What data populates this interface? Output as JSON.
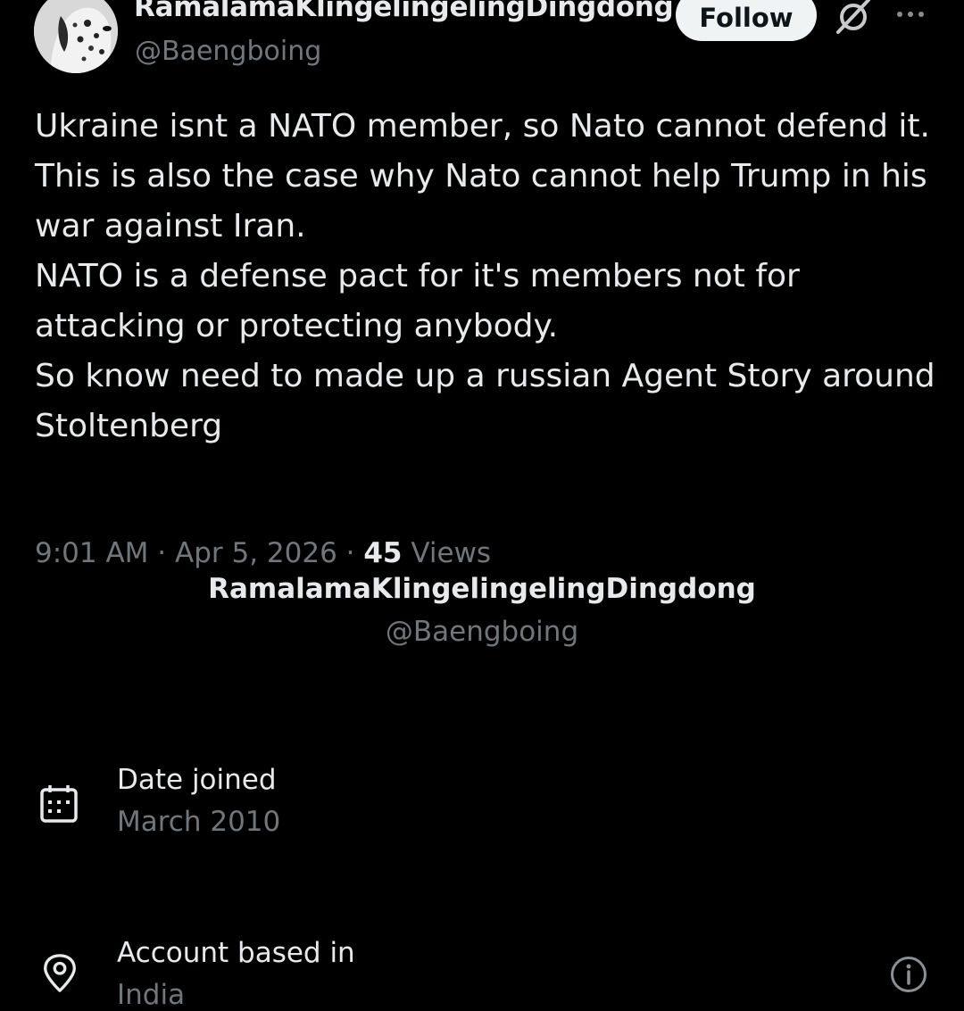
{
  "header": {
    "display_name": "RamalamaKlingelingelingDingdong",
    "handle": "@Baengboing",
    "follow_label": "Follow"
  },
  "tweet": {
    "text": "Ukraine isnt a  NATO member,  so Nato cannot defend it.\nThis is also the case why Nato cannot help Trump in his war against Iran.\nNATO is a defense pact for it's members not for attacking or protecting anybody.\nSo know need to made up a russian Agent Story around Stoltenberg",
    "time": "9:01 AM",
    "date": "Apr 5, 2026",
    "views_count": "45",
    "views_label": "Views"
  },
  "about": {
    "display_name": "RamalamaKlingelingelingDingdong",
    "handle": "@Baengboing",
    "date_joined_label": "Date joined",
    "date_joined_value": "March 2010",
    "location_label": "Account based in",
    "location_value": "India"
  },
  "icons": {
    "grok": "grok-icon",
    "more": "more-icon",
    "calendar": "calendar-icon",
    "location": "location-pin-icon",
    "info": "info-icon"
  }
}
